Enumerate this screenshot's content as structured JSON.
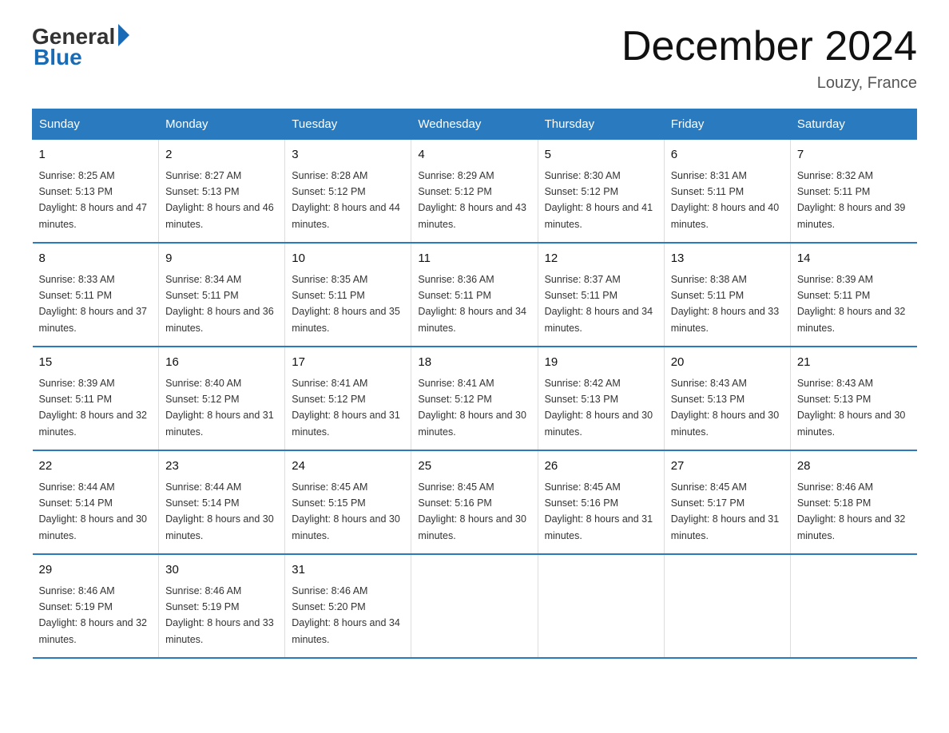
{
  "logo": {
    "general_text": "General",
    "blue_text": "Blue"
  },
  "title": "December 2024",
  "subtitle": "Louzy, France",
  "days_header": [
    "Sunday",
    "Monday",
    "Tuesday",
    "Wednesday",
    "Thursday",
    "Friday",
    "Saturday"
  ],
  "weeks": [
    [
      {
        "day": "1",
        "sunrise": "8:25 AM",
        "sunset": "5:13 PM",
        "daylight": "8 hours and 47 minutes."
      },
      {
        "day": "2",
        "sunrise": "8:27 AM",
        "sunset": "5:13 PM",
        "daylight": "8 hours and 46 minutes."
      },
      {
        "day": "3",
        "sunrise": "8:28 AM",
        "sunset": "5:12 PM",
        "daylight": "8 hours and 44 minutes."
      },
      {
        "day": "4",
        "sunrise": "8:29 AM",
        "sunset": "5:12 PM",
        "daylight": "8 hours and 43 minutes."
      },
      {
        "day": "5",
        "sunrise": "8:30 AM",
        "sunset": "5:12 PM",
        "daylight": "8 hours and 41 minutes."
      },
      {
        "day": "6",
        "sunrise": "8:31 AM",
        "sunset": "5:11 PM",
        "daylight": "8 hours and 40 minutes."
      },
      {
        "day": "7",
        "sunrise": "8:32 AM",
        "sunset": "5:11 PM",
        "daylight": "8 hours and 39 minutes."
      }
    ],
    [
      {
        "day": "8",
        "sunrise": "8:33 AM",
        "sunset": "5:11 PM",
        "daylight": "8 hours and 37 minutes."
      },
      {
        "day": "9",
        "sunrise": "8:34 AM",
        "sunset": "5:11 PM",
        "daylight": "8 hours and 36 minutes."
      },
      {
        "day": "10",
        "sunrise": "8:35 AM",
        "sunset": "5:11 PM",
        "daylight": "8 hours and 35 minutes."
      },
      {
        "day": "11",
        "sunrise": "8:36 AM",
        "sunset": "5:11 PM",
        "daylight": "8 hours and 34 minutes."
      },
      {
        "day": "12",
        "sunrise": "8:37 AM",
        "sunset": "5:11 PM",
        "daylight": "8 hours and 34 minutes."
      },
      {
        "day": "13",
        "sunrise": "8:38 AM",
        "sunset": "5:11 PM",
        "daylight": "8 hours and 33 minutes."
      },
      {
        "day": "14",
        "sunrise": "8:39 AM",
        "sunset": "5:11 PM",
        "daylight": "8 hours and 32 minutes."
      }
    ],
    [
      {
        "day": "15",
        "sunrise": "8:39 AM",
        "sunset": "5:11 PM",
        "daylight": "8 hours and 32 minutes."
      },
      {
        "day": "16",
        "sunrise": "8:40 AM",
        "sunset": "5:12 PM",
        "daylight": "8 hours and 31 minutes."
      },
      {
        "day": "17",
        "sunrise": "8:41 AM",
        "sunset": "5:12 PM",
        "daylight": "8 hours and 31 minutes."
      },
      {
        "day": "18",
        "sunrise": "8:41 AM",
        "sunset": "5:12 PM",
        "daylight": "8 hours and 30 minutes."
      },
      {
        "day": "19",
        "sunrise": "8:42 AM",
        "sunset": "5:13 PM",
        "daylight": "8 hours and 30 minutes."
      },
      {
        "day": "20",
        "sunrise": "8:43 AM",
        "sunset": "5:13 PM",
        "daylight": "8 hours and 30 minutes."
      },
      {
        "day": "21",
        "sunrise": "8:43 AM",
        "sunset": "5:13 PM",
        "daylight": "8 hours and 30 minutes."
      }
    ],
    [
      {
        "day": "22",
        "sunrise": "8:44 AM",
        "sunset": "5:14 PM",
        "daylight": "8 hours and 30 minutes."
      },
      {
        "day": "23",
        "sunrise": "8:44 AM",
        "sunset": "5:14 PM",
        "daylight": "8 hours and 30 minutes."
      },
      {
        "day": "24",
        "sunrise": "8:45 AM",
        "sunset": "5:15 PM",
        "daylight": "8 hours and 30 minutes."
      },
      {
        "day": "25",
        "sunrise": "8:45 AM",
        "sunset": "5:16 PM",
        "daylight": "8 hours and 30 minutes."
      },
      {
        "day": "26",
        "sunrise": "8:45 AM",
        "sunset": "5:16 PM",
        "daylight": "8 hours and 31 minutes."
      },
      {
        "day": "27",
        "sunrise": "8:45 AM",
        "sunset": "5:17 PM",
        "daylight": "8 hours and 31 minutes."
      },
      {
        "day": "28",
        "sunrise": "8:46 AM",
        "sunset": "5:18 PM",
        "daylight": "8 hours and 32 minutes."
      }
    ],
    [
      {
        "day": "29",
        "sunrise": "8:46 AM",
        "sunset": "5:19 PM",
        "daylight": "8 hours and 32 minutes."
      },
      {
        "day": "30",
        "sunrise": "8:46 AM",
        "sunset": "5:19 PM",
        "daylight": "8 hours and 33 minutes."
      },
      {
        "day": "31",
        "sunrise": "8:46 AM",
        "sunset": "5:20 PM",
        "daylight": "8 hours and 34 minutes."
      },
      null,
      null,
      null,
      null
    ]
  ]
}
